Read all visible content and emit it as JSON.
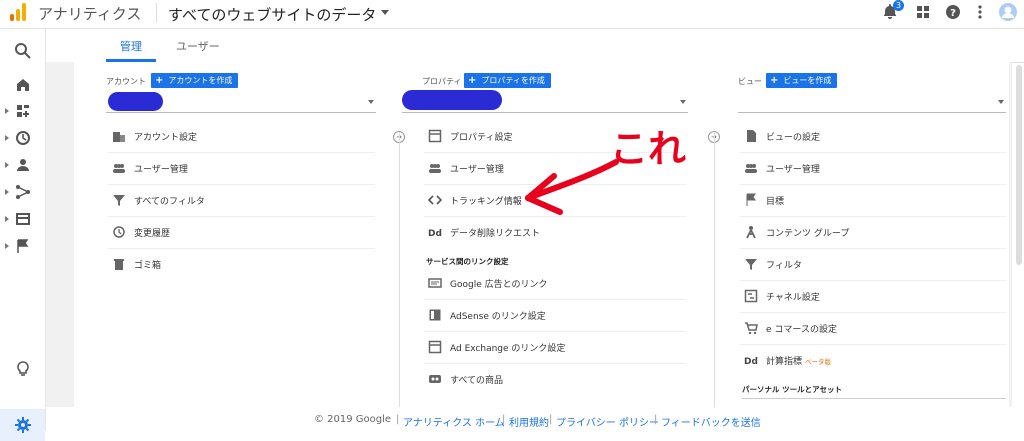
{
  "header": {
    "app_title": "アナリティクス",
    "site_title": "すべてのウェブサイトのデータ",
    "notification_count": "3"
  },
  "tabs": [
    {
      "label": "管理",
      "active": true
    },
    {
      "label": "ユーザー",
      "active": false
    }
  ],
  "account": {
    "header": "アカウント",
    "create_label": "アカウントを作成",
    "items": [
      {
        "label": "アカウント設定",
        "icon": "building-icon"
      },
      {
        "label": "ユーザー管理",
        "icon": "users-icon"
      },
      {
        "label": "すべてのフィルタ",
        "icon": "filter-icon"
      },
      {
        "label": "変更履歴",
        "icon": "history-icon"
      },
      {
        "label": "ゴミ箱",
        "icon": "trash-icon"
      }
    ]
  },
  "property": {
    "header": "プロパティ",
    "create_label": "プロパティを作成",
    "items": [
      {
        "label": "プロパティ設定",
        "icon": "property-settings-icon"
      },
      {
        "label": "ユーザー管理",
        "icon": "users-icon"
      },
      {
        "label": "トラッキング情報",
        "icon": "code-icon"
      },
      {
        "label": "データ削除リクエスト",
        "icon": "dd-icon"
      }
    ],
    "section_label": "サービス間のリンク設定",
    "link_items": [
      {
        "label": "Google 広告とのリンク",
        "icon": "google-ads-icon"
      },
      {
        "label": "AdSense のリンク設定",
        "icon": "adsense-icon"
      },
      {
        "label": "Ad Exchange のリンク設定",
        "icon": "ad-exchange-icon"
      },
      {
        "label": "すべての商品",
        "icon": "products-icon"
      }
    ]
  },
  "view": {
    "header": "ビュー",
    "create_label": "ビューを作成",
    "items": [
      {
        "label": "ビューの設定",
        "icon": "document-icon"
      },
      {
        "label": "ユーザー管理",
        "icon": "users-icon"
      },
      {
        "label": "目標",
        "icon": "flag-icon"
      },
      {
        "label": "コンテンツ グループ",
        "icon": "content-group-icon"
      },
      {
        "label": "フィルタ",
        "icon": "filter-icon"
      },
      {
        "label": "チャネル設定",
        "icon": "channel-icon"
      },
      {
        "label": "e コマースの設定",
        "icon": "cart-icon"
      },
      {
        "label": "計算指標",
        "icon": "dd-icon",
        "badge": "ベータ版"
      }
    ],
    "section_label": "パーソナル ツールとアセット"
  },
  "annotation": {
    "text": "これ",
    "color": "#e8001c"
  },
  "footer": {
    "copyright": "© 2019 Google",
    "links": [
      "アナリティクス ホーム",
      "利用規約",
      "プライバシー ポリシー",
      "フィードバックを送信"
    ]
  },
  "colors": {
    "accent": "#1a73e8",
    "logo_orange": "#f9ab00",
    "logo_dark": "#e37400"
  }
}
